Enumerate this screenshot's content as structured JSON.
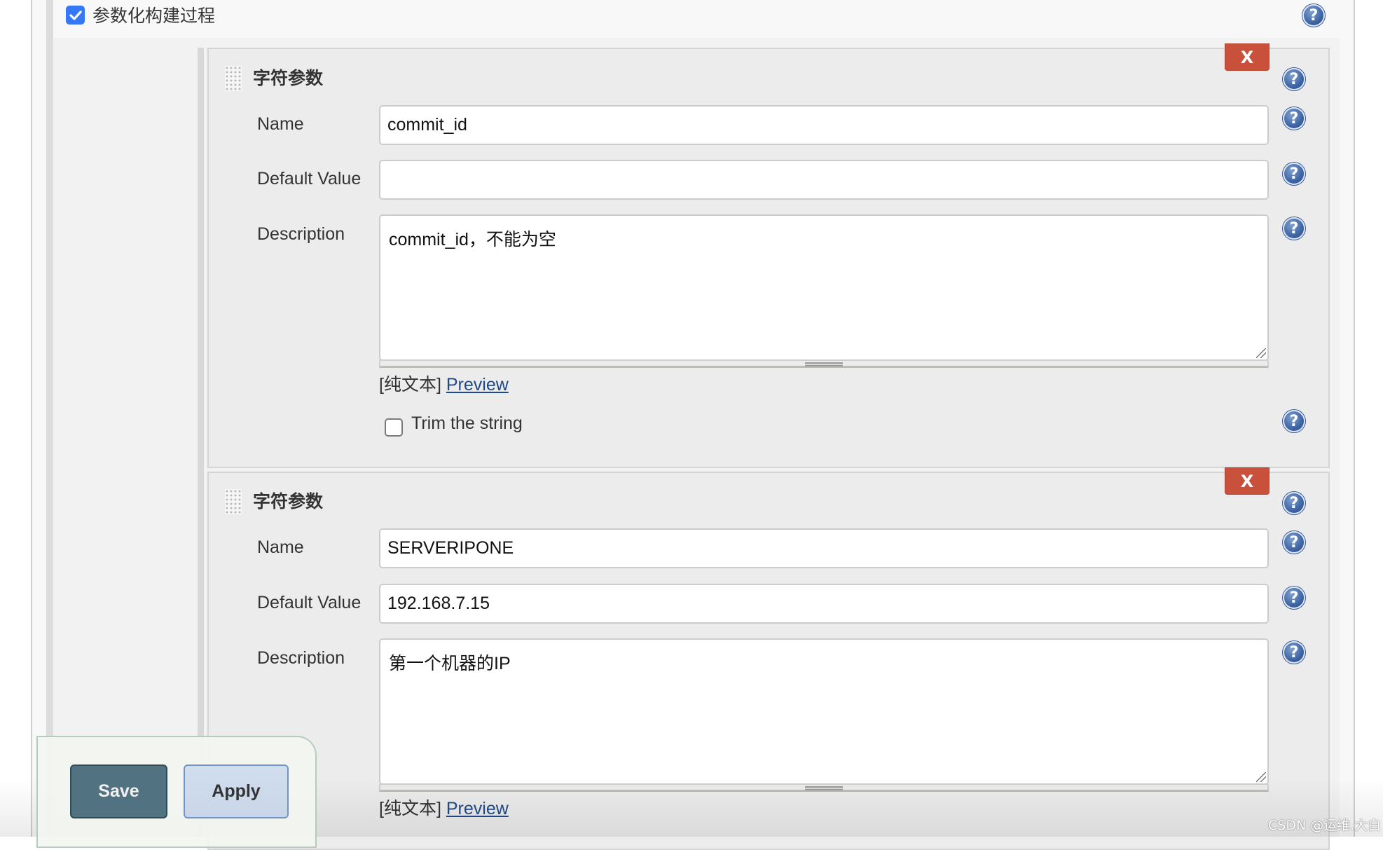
{
  "header": {
    "checkbox_checked": true,
    "title": "参数化构建过程",
    "help_icon": "help-icon"
  },
  "parameters": [
    {
      "type_title": "字符参数",
      "delete_label": "X",
      "fields": {
        "name_label": "Name",
        "name_value": "commit_id",
        "default_label": "Default Value",
        "default_value": "",
        "description_label": "Description",
        "description_value": "commit_id，不能为空"
      },
      "markup_note": "[纯文本]",
      "preview_label": "Preview",
      "trim_label": "Trim the string",
      "trim_checked": false
    },
    {
      "type_title": "字符参数",
      "delete_label": "X",
      "fields": {
        "name_label": "Name",
        "name_value": "SERVERIPONE",
        "default_label": "Default Value",
        "default_value": "192.168.7.15",
        "description_label": "Description",
        "description_value": "第一个机器的IP"
      },
      "markup_note": "[纯文本]",
      "preview_label": "Preview"
    }
  ],
  "actions": {
    "save_label": "Save",
    "apply_label": "Apply"
  },
  "watermark": "CSDN @运维.大白",
  "colors": {
    "checkbox_blue": "#3478f6",
    "delete_red": "#c9503b",
    "save_bg": "#517381",
    "apply_bg": "#d2deee",
    "link_blue": "#204a87"
  }
}
